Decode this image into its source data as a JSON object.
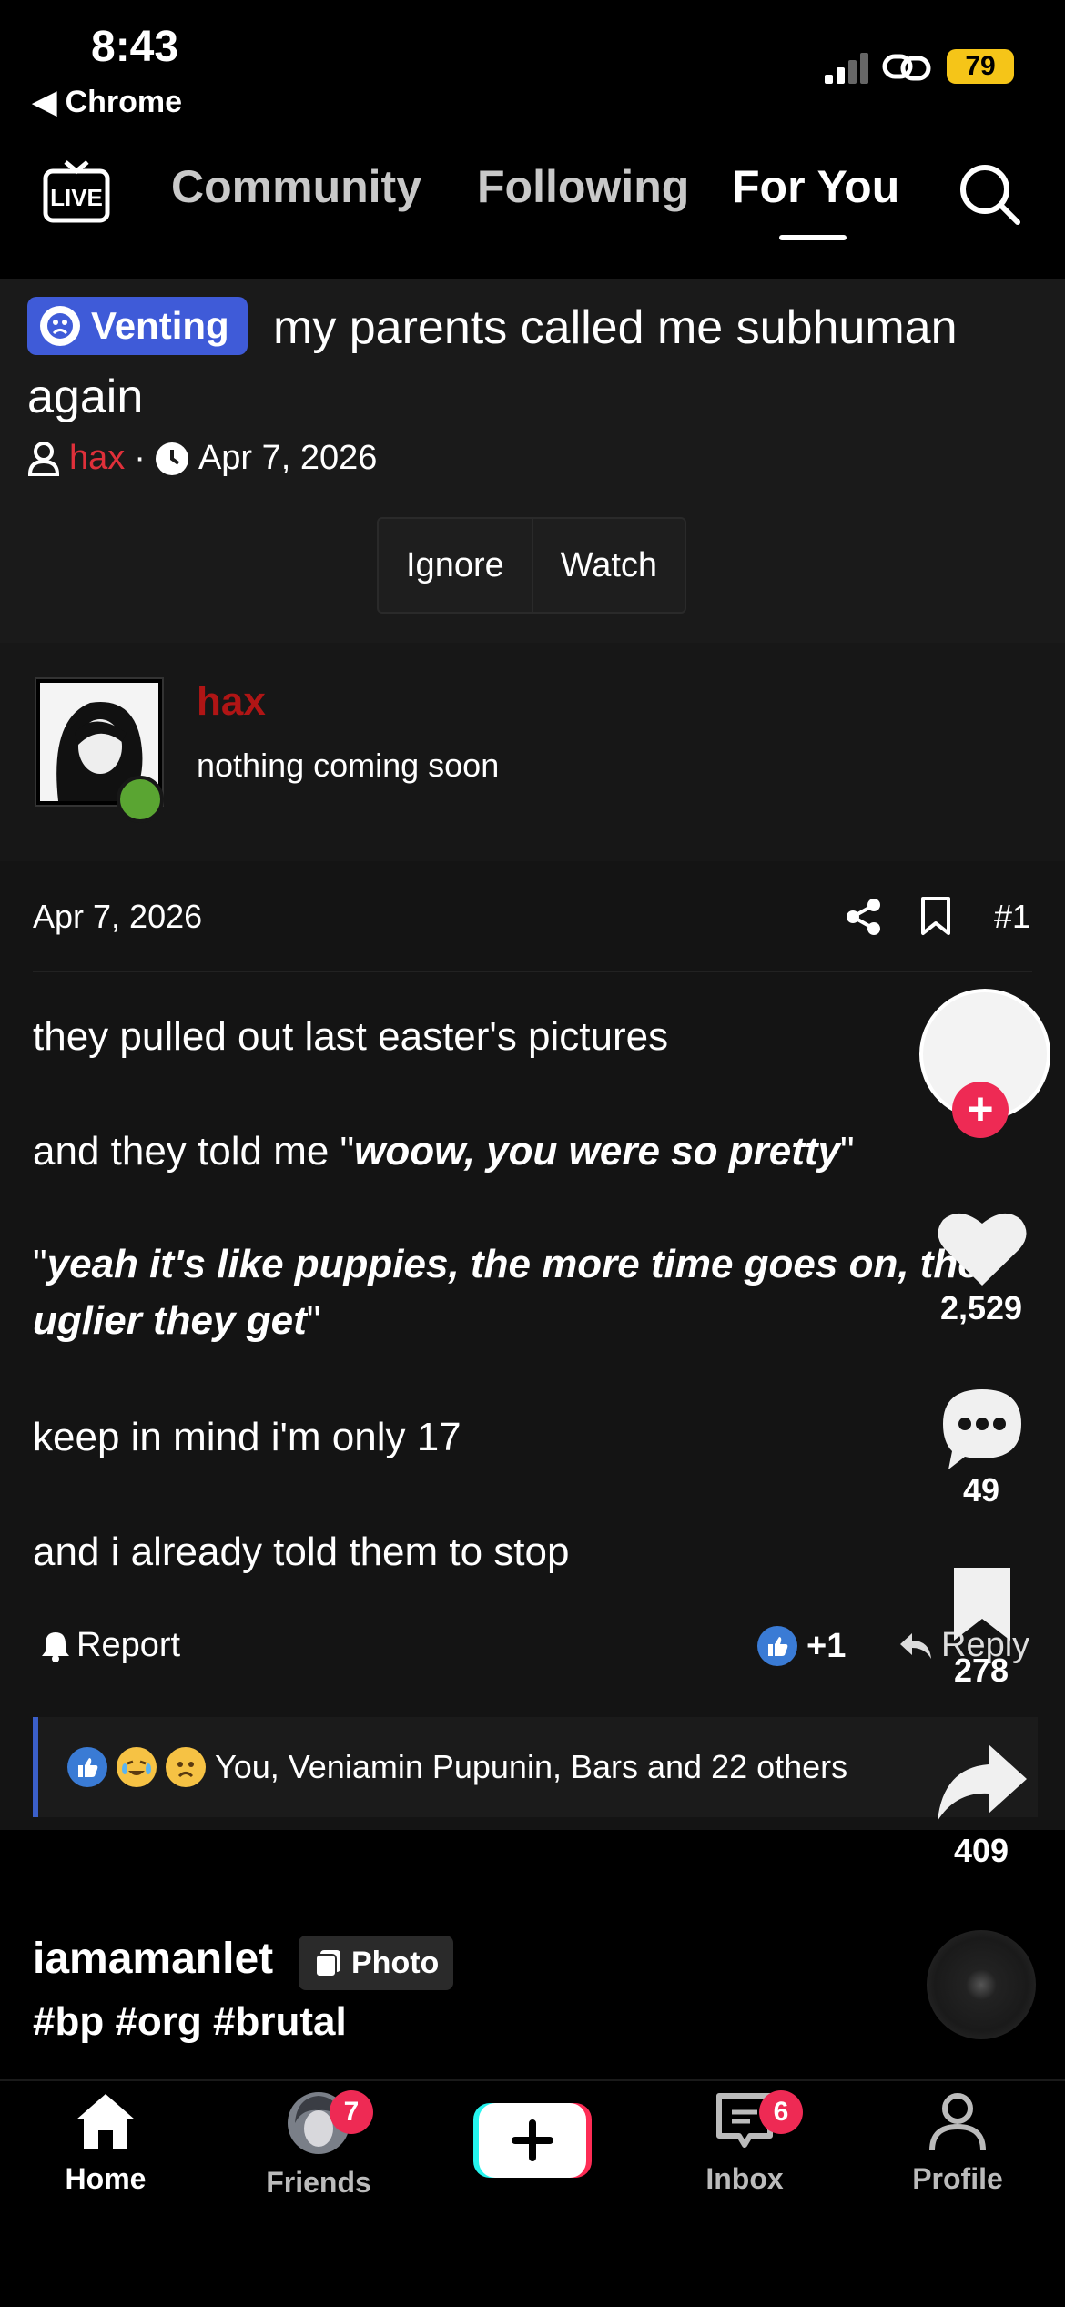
{
  "status_bar": {
    "time": "8:43",
    "back_app": "◀ Chrome",
    "battery": "79"
  },
  "top_nav": {
    "tabs": [
      {
        "label": "Community"
      },
      {
        "label": "Following"
      },
      {
        "label": "For You",
        "active": true
      }
    ]
  },
  "thread": {
    "tag": "Venting",
    "title": "my parents called me subhuman again",
    "author": "hax",
    "separator": "·",
    "date": "Apr 7, 2026",
    "buttons": {
      "ignore": "Ignore",
      "watch": "Watch"
    }
  },
  "user_card": {
    "name": "hax",
    "status": "nothing coming soon"
  },
  "post": {
    "date": "Apr 7, 2026",
    "number": "#1",
    "lines": {
      "l1": "they pulled out last easter's pictures",
      "l2_pre": "and they told me \"",
      "l2_em": "woow, you were so pretty",
      "l2_post": "\"",
      "l3_pre": "\"",
      "l3_em": "yeah it's like puppies, the more time goes on, the uglier they get",
      "l3_post": "\"",
      "l4": "keep in mind i'm only 17",
      "l5": "and i already told them to stop"
    },
    "report": "Report",
    "like_count": "+1",
    "reply": "Reply",
    "reactions_text": "You, Veniamin Pupunin, Bars and 22 others"
  },
  "rail": {
    "likes": "2,529",
    "comments": "49",
    "saves": "278",
    "shares": "409"
  },
  "caption": {
    "user": "iamamanlet",
    "badge": "Photo",
    "hashtags": "#bp #org #brutal"
  },
  "tabbar": {
    "home": "Home",
    "friends": "Friends",
    "friends_badge": "7",
    "inbox": "Inbox",
    "inbox_badge": "6",
    "profile": "Profile"
  },
  "colors": {
    "accent_red": "#ee2a54",
    "venting_blue": "#3f5bd8",
    "author_red": "#e0303a",
    "online_green": "#5aa532"
  }
}
